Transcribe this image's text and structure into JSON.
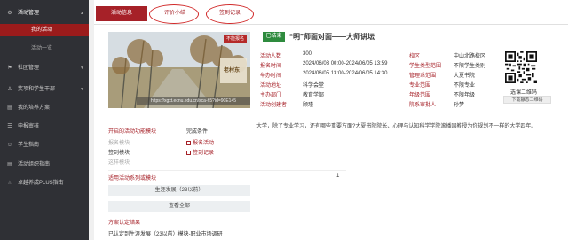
{
  "sidebar": {
    "items": [
      {
        "icon": "gear-icon",
        "label": "活动管理",
        "open": true
      },
      {
        "sub": "我的活动",
        "active": true
      },
      {
        "sub": "活动一览",
        "active": false
      },
      {
        "icon": "group-icon",
        "label": "社团管理"
      },
      {
        "icon": "person-icon",
        "label": "奖项和学生干部"
      },
      {
        "icon": "doc-icon",
        "label": "我的培养方案"
      },
      {
        "icon": "list-icon",
        "label": "申报审核"
      },
      {
        "icon": "user-icon",
        "label": "学生指南"
      },
      {
        "icon": "doc-icon",
        "label": "活动组织指南"
      },
      {
        "icon": "star-icon",
        "label": "卓越养成PLUS指南"
      }
    ]
  },
  "tabs": {
    "info": "活动信息",
    "review": "评价小结",
    "signin": "签到记录"
  },
  "poster": {
    "url": "https://xgxt.ecnu.edu.cn/sca-h5?id=90E145",
    "badge": "不能报名",
    "sign": "老村东"
  },
  "activity": {
    "status": "已结束",
    "title": "“明”师面对面——大师讲坛",
    "left": [
      {
        "k": "活动人数",
        "v": "300"
      },
      {
        "k": "报名时间",
        "v": "2024/06/03 00:00-2024/06/05 13:59"
      },
      {
        "k": "举办时间",
        "v": "2024/06/05 13:00-2024/06/05 14:30"
      },
      {
        "k": "活动地址",
        "v": "科学会堂"
      },
      {
        "k": "主办部门",
        "v": "教育学部"
      },
      {
        "k": "活动创建者",
        "v": "顾瑾"
      }
    ],
    "right": [
      {
        "k": "校区",
        "v": "中山北路校区"
      },
      {
        "k": "学生类型范围",
        "v": "不限学生类别"
      },
      {
        "k": "管理系范围",
        "v": "大夏书院"
      },
      {
        "k": "专业范围",
        "v": "不限专业"
      },
      {
        "k": "年级范围",
        "v": "不限年级"
      },
      {
        "k": "院系审批人",
        "v": "孙梦"
      }
    ],
    "description": "大学，除了专业学习，还有哪些重要方面?大夏书院院长、心理与认知科学学院滚播国教授为你规划不一样的大学四年。"
  },
  "qr": {
    "label": "选课二维码",
    "download": "下载静态二维码"
  },
  "modules": {
    "open_heading": "开启的活动功能模块",
    "done_heading": "完成条件",
    "open_items": [
      "报名模块",
      "签到模块",
      "这样模块"
    ],
    "done_items": [
      "报名活动",
      "签到记录"
    ],
    "series_heading": "适用活动系列或模块",
    "series_count": "1",
    "series_btn": "生涯发展（23以前）",
    "view_all": "查看全部",
    "result_heading": "方案认定结果",
    "result_text": "已认定到生涯发展（23以前）模块-职业市场调研"
  },
  "colors": {
    "accent": "#a62128",
    "status_green": "#2e8b3e",
    "sidebar_bg": "#2f3035"
  }
}
